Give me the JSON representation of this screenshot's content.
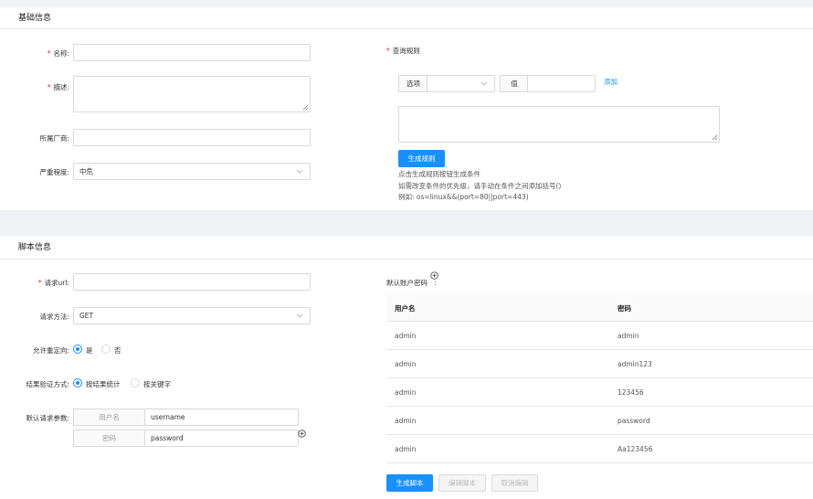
{
  "basic": {
    "title": "基础信息",
    "name_label": "名称:",
    "name_value": "",
    "desc_label": "描述:",
    "vendor_label": "所属厂商:",
    "vendor_value": "",
    "severity_label": "严重程度:",
    "severity_value": "中危",
    "query_label": "查询规则",
    "option_addon": "选项",
    "option_value": "",
    "value_addon": "值",
    "value_value": "",
    "add_link": "添加",
    "generate_rule_button": "生成规则",
    "hint_line1": "点击生成规则按钮生成条件",
    "hint_line2": "如需改变条件的优先级，请手动在条件之间添加括号()",
    "hint_line3": "例如: os=linux&&(port=80||port=443)"
  },
  "script": {
    "title": "脚本信息",
    "url_label": "请求url:",
    "url_value": "",
    "method_label": "请求方法:",
    "method_value": "GET",
    "redirect_label": "允许重定向:",
    "redirect_yes": "是",
    "redirect_no": "否",
    "verify_label": "结果验证方式:",
    "verify_opt1": "按结果统计",
    "verify_opt2": "按关键字",
    "params_label": "默认请求参数:",
    "param1_key": "用户名",
    "param1_value": "username",
    "param2_key": "密码",
    "param2_value": "password",
    "accounts_label": "默认账户密码",
    "accounts_colon": ":",
    "table": {
      "headers": [
        "用户名",
        "密码"
      ],
      "rows": [
        [
          "admin",
          "admin"
        ],
        [
          "admin",
          "admin123"
        ],
        [
          "admin",
          "123456"
        ],
        [
          "admin",
          "password"
        ],
        [
          "admin",
          "Aa123456"
        ]
      ]
    },
    "generate_script_button": "生成脚本",
    "edit_script_button": "编辑脚本",
    "cancel_edit_button": "取消编辑"
  },
  "colors": {
    "primary": "#1890ff",
    "required": "#f5222d"
  }
}
